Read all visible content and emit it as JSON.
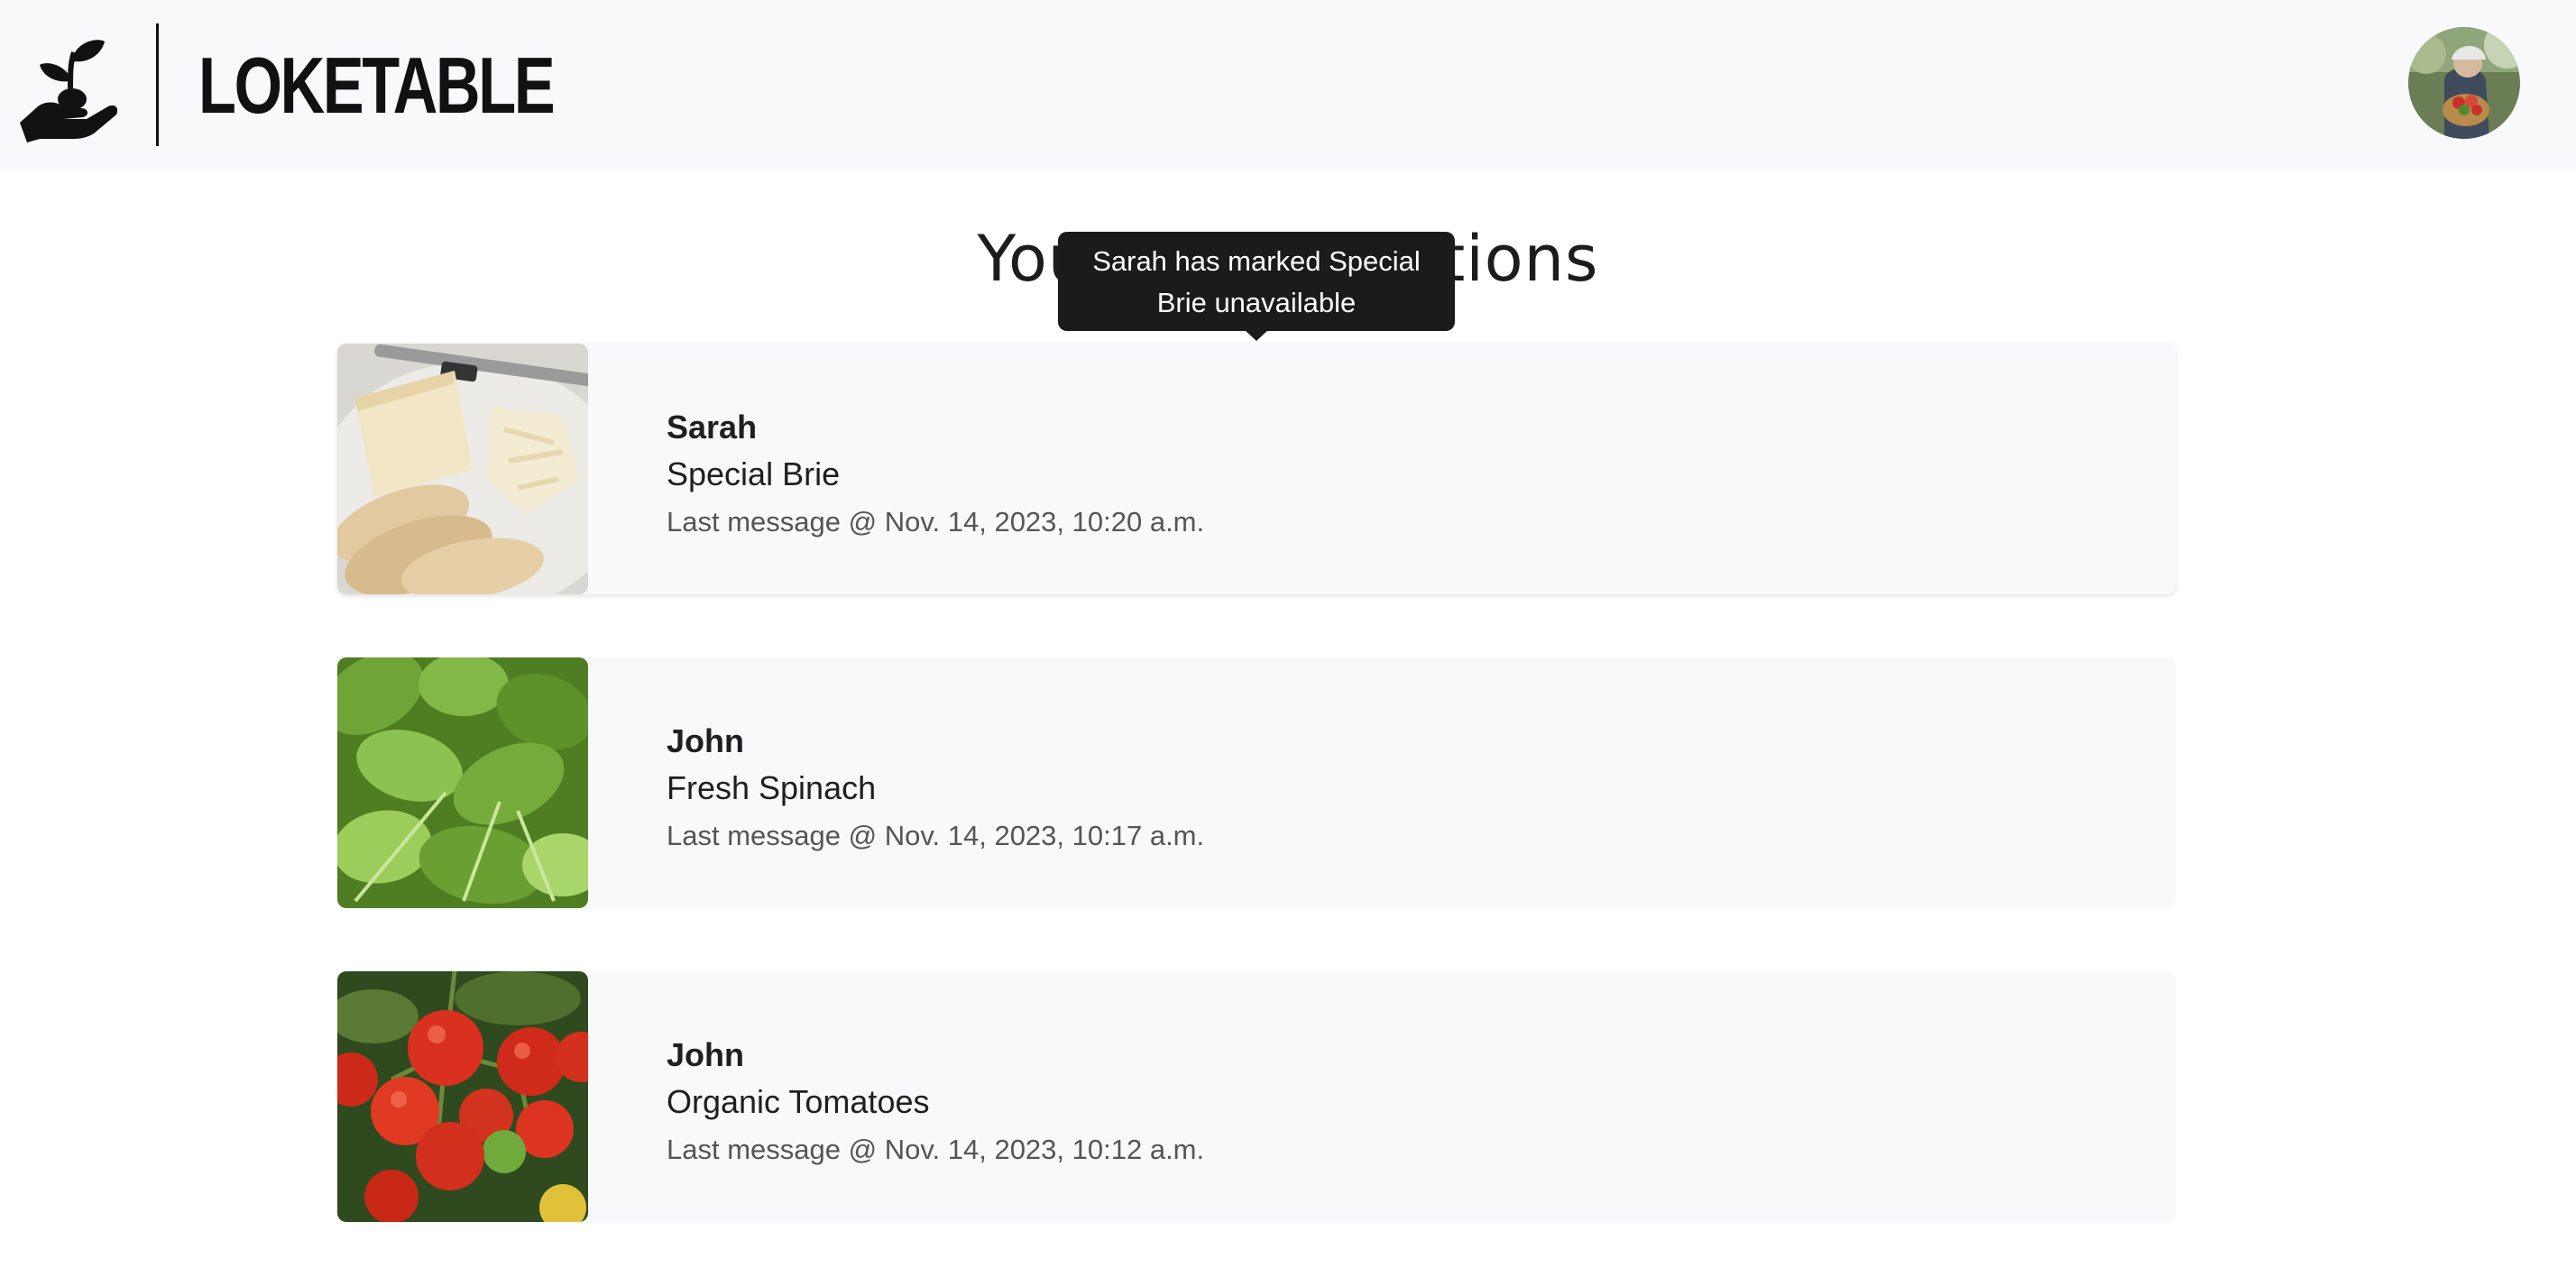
{
  "header": {
    "brand": "LOKETABLE",
    "logo_icon": "hand-sprout-icon",
    "avatar_icon": "user-avatar"
  },
  "page": {
    "title": "Your Conversations"
  },
  "tooltip": {
    "line1": "Sarah has marked Special",
    "line2": "Brie unavailable"
  },
  "conversations": [
    {
      "name": "Sarah",
      "item": "Special Brie",
      "last_message": "Last message @ Nov. 14, 2023, 10:20 a.m.",
      "thumb_icon": "brie-cheese-photo"
    },
    {
      "name": "John",
      "item": "Fresh Spinach",
      "last_message": "Last message @ Nov. 14, 2023, 10:17 a.m.",
      "thumb_icon": "spinach-photo"
    },
    {
      "name": "John",
      "item": "Organic Tomatoes",
      "last_message": "Last message @ Nov. 14, 2023, 10:12 a.m.",
      "thumb_icon": "tomatoes-photo"
    }
  ]
}
